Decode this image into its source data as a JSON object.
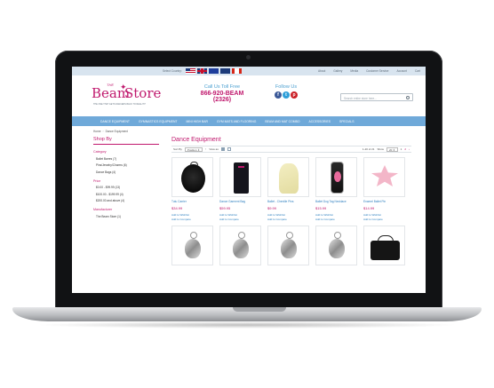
{
  "topbar": {
    "select_country": "Select Country:",
    "flags": [
      "us-flag",
      "uk-flag",
      "eu-flag",
      "australia-flag",
      "canada-flag"
    ],
    "links": [
      "About",
      "Gallery",
      "Media",
      "Customer Service"
    ],
    "account": "Account",
    "cart": "Cart"
  },
  "header": {
    "logo_the": "THE",
    "logo_beam": "Beam",
    "logo_store": "Store",
    "logo_tagline": "THE ONE THAT GETS DANCERS BACK TO REALITY!",
    "toll_free_label": "Call Us Toll Free",
    "toll_free_number": "866-920-BEAM (2326)",
    "follow_us": "Follow Us",
    "search_placeholder": "Search entire store here..."
  },
  "nav": [
    "DANCE EQUIPMENT",
    "GYMNASTICS EQUIPMENT",
    "MINI HIGH BAR",
    "GYM MATS AND FLOORING",
    "BEAM AND MAT COMBO",
    "ACCESSORIES",
    "SPECIALS"
  ],
  "breadcrumb": {
    "home": "Home",
    "current": "Dance Equipment"
  },
  "sidebar": {
    "shop_by": "Shop By",
    "category_title": "Category",
    "categories": [
      "Ballet Barres (7)",
      "Pins/Jewelry/Charms (6)",
      "Dance Bags (4)"
    ],
    "price_title": "Price",
    "prices": [
      "$0.00 - $99.99 (13)",
      "$100.00 - $199.99 (4)",
      "$200.00 and above (4)"
    ],
    "manufacturer_title": "Manufacturer",
    "manufacturers": [
      "The Beam Store (1)"
    ]
  },
  "content": {
    "title": "Dance Equipment",
    "sort_by": "Sort By",
    "sort_value": "Position",
    "view_as": "View as",
    "items_count": "1-20 of 21",
    "show": "Show",
    "show_value": "20",
    "pages": [
      "1",
      "2"
    ],
    "products": [
      {
        "name": "Tutu Carrier",
        "price": "$34.99",
        "image": "tutu-carrier-image"
      },
      {
        "name": "Dance Garment Bag",
        "price": "$59.95",
        "image": "garment-bag-image"
      },
      {
        "name": "Ballet - Chenille Pins",
        "price": "$9.99",
        "image": "chenille-pins-image"
      },
      {
        "name": "Ballet Dog Tag Necklace",
        "price": "$15.99",
        "image": "dog-tag-image"
      },
      {
        "name": "Enamel Ballet Pin",
        "price": "$14.99",
        "image": "enamel-pin-image"
      }
    ],
    "wishlist": "Add to Wishlist",
    "compare": "Add to Compare"
  },
  "colors": {
    "accent": "#c0186d",
    "nav": "#6fa9d9",
    "link": "#2d7fbf",
    "topbar": "#d8e4ef"
  }
}
